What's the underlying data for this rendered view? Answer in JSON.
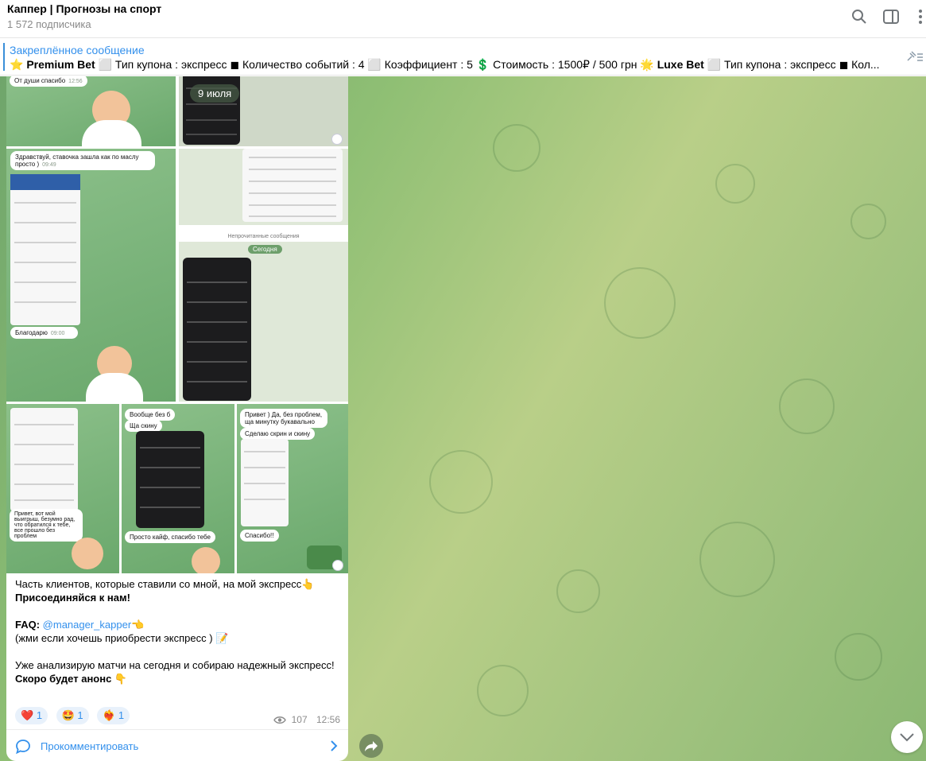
{
  "header": {
    "title": "Каппер | Прогнозы на спорт",
    "subscribers": "1 572 подписчика"
  },
  "pinned": {
    "label": "Закреплённое сообщение",
    "text_parts": [
      "⭐ ",
      "Premium Bet",
      " ⬜ Тип купона : экспресс ◼ Количество событий : 4 ⬜ Коэффициент : 5 💲 Стоимость : 1500₽ / 500 грн 🌟 ",
      "Luxe Bet",
      " ⬜ Тип купона : экспресс ◼ Кол..."
    ]
  },
  "chat_media": {
    "bubble1": "От души спасибо",
    "bubble1_time": "12:56",
    "date_pill": "9 июля",
    "bubble2": "Здравствуй, ставочка зашла как по маслу просто )",
    "bubble2_time": "09:49",
    "bubble3": "Благодарю",
    "bubble3_time": "09:00",
    "unread": "Непрочитанные сообщения",
    "today": "Сегодня",
    "b4": "Вообще без б",
    "b5": "Ща скину",
    "b6": "Просто кайф, спасибо тебе",
    "b7": "Привет ) Да, без проблем, ща минутку букавально",
    "b8": "Сделаю скрин и скину",
    "b9": "Спасибо!!",
    "b10": "Привет, вот мой выигрыш, безумно рад, что обратился к тебе, все прошло без проблем"
  },
  "message": {
    "line1": "Часть клиентов, которые ставили со мной, на мой экспресс👆",
    "line2": "Присоединяйся к нам!",
    "faq_label": "FAQ: ",
    "faq_link": "@manager_kapper",
    "faq_emoji": "👈",
    "line4": "(жми если хочешь приобрести экспресс ) 📝",
    "line5": "Уже анализирую матчи на сегодня и собираю надежный экспресс!",
    "line6": "Скоро будет анонс 👇"
  },
  "reactions": [
    {
      "emoji": "❤️",
      "count": "1"
    },
    {
      "emoji": "🤩",
      "count": "1"
    },
    {
      "emoji": "❤️‍🔥",
      "count": "1"
    }
  ],
  "meta": {
    "views": "107",
    "time": "12:56"
  },
  "comment_label": "Прокомментировать"
}
